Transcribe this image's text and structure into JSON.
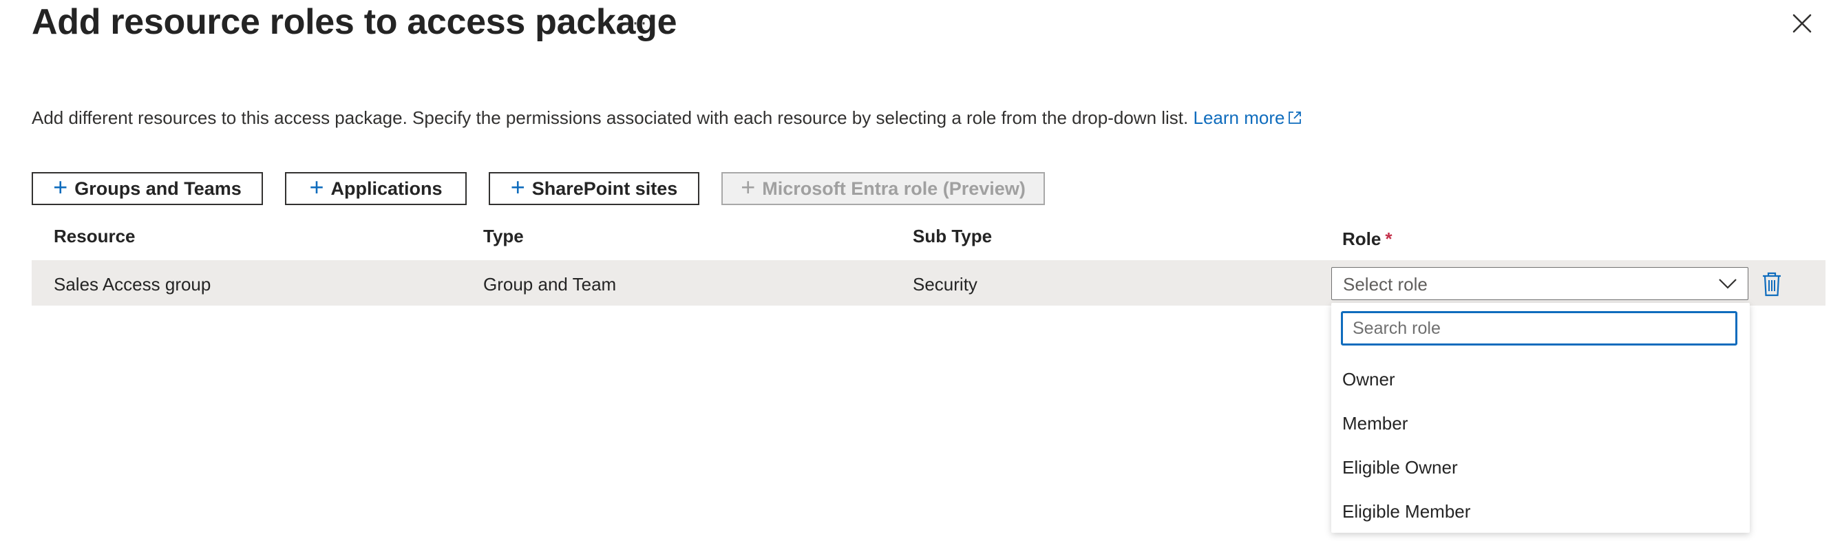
{
  "header": {
    "title": "Add resource roles to access package",
    "more_label": "···"
  },
  "description": {
    "text": "Add different resources to this access package. Specify the permissions associated with each resource by selecting a role from the drop-down list.",
    "learn_more": "Learn more"
  },
  "toolbar": {
    "groups_label": "Groups and Teams",
    "applications_label": "Applications",
    "sharepoint_label": "SharePoint sites",
    "entra_label": "Microsoft Entra role (Preview)"
  },
  "table": {
    "columns": {
      "resource": "Resource",
      "type": "Type",
      "subtype": "Sub Type",
      "role": "Role",
      "required_marker": "*"
    },
    "rows": [
      {
        "resource": "Sales Access group",
        "type": "Group and Team",
        "subtype": "Security",
        "role_placeholder": "Select role"
      }
    ]
  },
  "role_dropdown": {
    "search_placeholder": "Search role",
    "options": [
      "Owner",
      "Member",
      "Eligible Owner",
      "Eligible Member"
    ]
  },
  "colors": {
    "accent": "#0f6cbd",
    "required": "#c4314b",
    "row_highlight": "#edebe9"
  }
}
